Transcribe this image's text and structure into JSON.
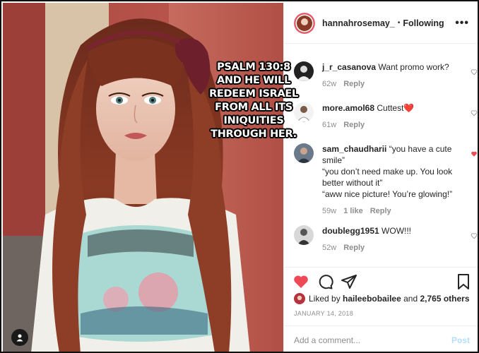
{
  "post": {
    "username": "hannahrosemay_",
    "separator": "•",
    "follow_status": "Following",
    "more_label": "•••"
  },
  "overlay": {
    "text": "PSALM 130:8 AND HE WILL REDEEM ISRAEL FROM ALL ITS INIQUITIES THROUGH HER."
  },
  "comments": [
    {
      "user": "j_r_casanova",
      "text": "Want promo work?",
      "age": "62w",
      "likes": "",
      "reply": "Reply",
      "liked": false
    },
    {
      "user": "more.amol68",
      "text": "Cuttest❤️",
      "age": "61w",
      "likes": "",
      "reply": "Reply",
      "liked": false
    },
    {
      "user": "sam_chaudharii",
      "text": "“you have a cute smile”\n“you don’t need make up. You look better without it”\n“aww nice picture! You’re glowing!”",
      "age": "59w",
      "likes": "1 like",
      "reply": "Reply",
      "liked": true
    },
    {
      "user": "doublegg1951",
      "text": "WOW!!!",
      "age": "52w",
      "likes": "",
      "reply": "Reply",
      "liked": false
    }
  ],
  "likes": {
    "prefix": "Liked by",
    "user": "haileebobailee",
    "middle": "and",
    "others": "2,765 others"
  },
  "date": "JANUARY 14, 2018",
  "add_comment": {
    "placeholder": "Add a comment...",
    "post_label": "Post"
  },
  "colors": {
    "like_red": "#ed4956",
    "text": "#262626",
    "muted": "#8e8e8e",
    "post_disabled": "#b2dffc"
  },
  "icons": {
    "like": "heart-filled-icon",
    "comment": "comment-bubble-icon",
    "share": "paper-plane-icon",
    "save": "bookmark-icon",
    "tag": "user-tag-icon",
    "more": "ellipsis-icon"
  }
}
